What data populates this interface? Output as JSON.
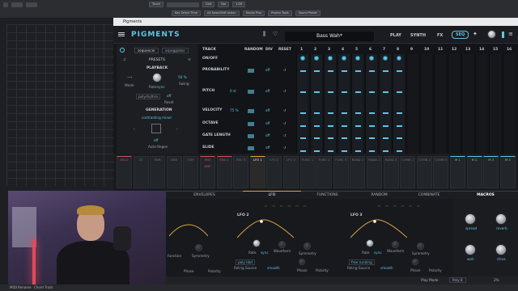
{
  "window_title": "Pigments",
  "daw": {
    "top_items": [
      "Touch",
      "Grid",
      "Bar",
      "1/16"
    ],
    "top_chips": [
      "Key Select Time",
      "A4 Swar/Shift Action",
      "Studio Plus",
      "Project Tools",
      "Sound Preset"
    ],
    "status_left": "MIDI Rename",
    "status_mid": "Chord Track"
  },
  "plugin": {
    "logo": "PIGMENTS",
    "preset_name": "Bass Wah*",
    "nav": [
      "PLAY",
      "SYNTH",
      "FX",
      "SEQ"
    ],
    "active_nav": "SEQ"
  },
  "left_panel": {
    "tabs": [
      "sequencer",
      "arpeggiator"
    ],
    "presets_label": "PRESETS",
    "playback_label": "PLAYBACK",
    "mode_label": "Mode",
    "rate_label": "Rate",
    "rate_value": "sync",
    "swing_label": "Swing",
    "swing_value": "50 %",
    "polyrhythm_label": "polyrhythm",
    "off_value": "off",
    "reset_label": "Reset",
    "generation_label": "GENERATION",
    "gen_mode": "contrasting minor",
    "autoregen_value": "off",
    "autoregen_label": "Auto-Regen"
  },
  "sequencer": {
    "headers": [
      "TRACK",
      "RANDOM",
      "DIV",
      "RESET"
    ],
    "step_numbers": [
      "1",
      "2",
      "3",
      "4",
      "5",
      "6",
      "7",
      "8",
      "9",
      "10",
      "11",
      "12",
      "13",
      "14",
      "15",
      "16"
    ],
    "rows": [
      {
        "label": "ON/OFF",
        "random": "",
        "div": "",
        "reset": ""
      },
      {
        "label": "PROBABILITY",
        "random": "",
        "div": "off",
        "reset": ""
      },
      {
        "label": "PITCH",
        "random": "0 st",
        "div": "off",
        "reset": ""
      },
      {
        "label": "VELOCITY",
        "random": "75 %",
        "div": "off",
        "reset": ""
      },
      {
        "label": "OCTAVE",
        "random": "",
        "div": "off",
        "reset": ""
      },
      {
        "label": "GATE LENGTH",
        "random": "",
        "div": "off",
        "reset": ""
      },
      {
        "label": "SLIDE",
        "random": "",
        "div": "off",
        "reset": ""
      }
    ]
  },
  "mod_sources": [
    "VELO",
    "AT",
    "SNR",
    "KBD",
    "EXP",
    "ENV AMP",
    "ENV 2",
    "ENV 3",
    "LFO 1",
    "LFO 2",
    "LFO 3",
    "FUNC 1",
    "FUNC 2",
    "FUNC 3",
    "RAND 1",
    "RAND 2",
    "RAND 3",
    "COMB 1",
    "COMB 2",
    "COMB 3",
    "M 1",
    "M 2",
    "M 3",
    "M 4"
  ],
  "bottom_tabs": [
    "ENVELOPES",
    "LFO",
    "FUNCTIONS",
    "RANDOM",
    "COMBINATE",
    "MACROS"
  ],
  "active_bottom_tab": "LFO",
  "lfos": [
    {
      "name": "LFO 2",
      "rate_label": "Rate",
      "rate_value": "sync",
      "waveform": "Waveform",
      "symmetry": "Symmetry",
      "retrig_label": "Retrig Source",
      "retrig_value": "poly kbd",
      "smooth": "smooth",
      "phase": "Phase",
      "polarity": "Polarity"
    },
    {
      "name": "LFO 3",
      "rate_label": "Rate",
      "rate_value": "sync",
      "waveform": "Waveform",
      "symmetry": "Symmetry",
      "retrig_label": "Retrig Source",
      "retrig_value": "free running",
      "smooth": "smooth",
      "phase": "Phase",
      "polarity": "Polarity"
    }
  ],
  "lfo1_partial": {
    "symmetry": "Symmetry",
    "phase": "Phase",
    "polarity": "Polarity",
    "function": "function"
  },
  "macros": [
    "spread",
    "reverb",
    "wah",
    "drive"
  ],
  "bottom_bar": {
    "play_mode_label": "Play Mode",
    "play_mode_value": "Poly 8",
    "cpu": "2%"
  },
  "colors": {
    "accent": "#5fc6e6",
    "lfo_orange": "#d9a441",
    "env_red": "#c8555a"
  }
}
